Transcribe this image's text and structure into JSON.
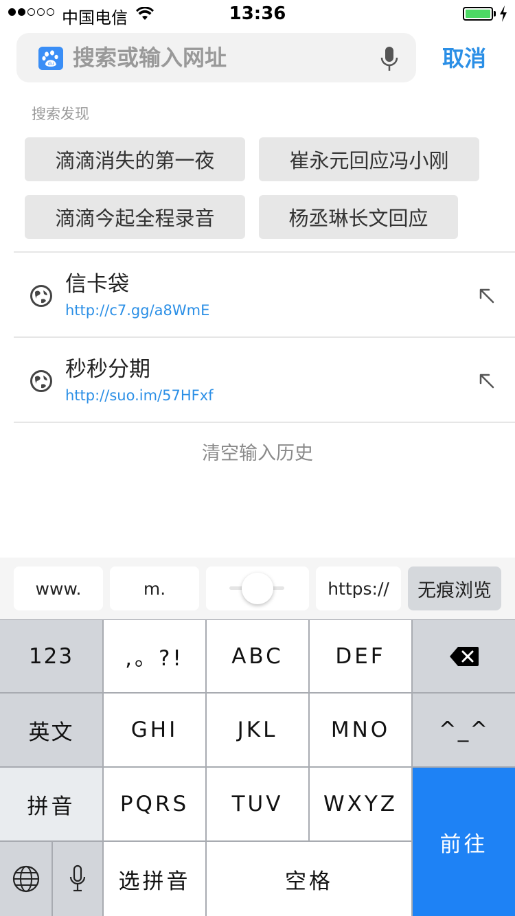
{
  "status": {
    "carrier": "中国电信",
    "time": "13:36",
    "battery_level": 1.0
  },
  "search": {
    "placeholder": "搜索或输入网址",
    "cancel": "取消"
  },
  "discovery": {
    "title": "搜索发现",
    "chips": [
      "滴滴消失的第一夜",
      "崔永元回应冯小刚",
      "滴滴今起全程录音",
      "杨丞琳长文回应"
    ]
  },
  "history": [
    {
      "title": "信卡袋",
      "url": "http://c7.gg/a8WmE"
    },
    {
      "title": "秒秒分期",
      "url": "http://suo.im/57HFxf"
    }
  ],
  "clear_history": "清空输入历史",
  "shortcuts": {
    "www": "www.",
    "m": "m.",
    "https": "https://",
    "incognito": "无痕浏览"
  },
  "keyboard": {
    "row1": [
      "123",
      ",。?!",
      "ABC",
      "DEF"
    ],
    "row2": [
      "英文",
      "GHI",
      "JKL",
      "MNO",
      "^_^"
    ],
    "row3": [
      "拼音",
      "PQRS",
      "TUV",
      "WXYZ"
    ],
    "row4": [
      "选拼音",
      "空格"
    ],
    "go": "前往"
  },
  "colors": {
    "accent": "#2b8fe6",
    "go_key": "#1e82f5",
    "battery": "#4cd964"
  }
}
